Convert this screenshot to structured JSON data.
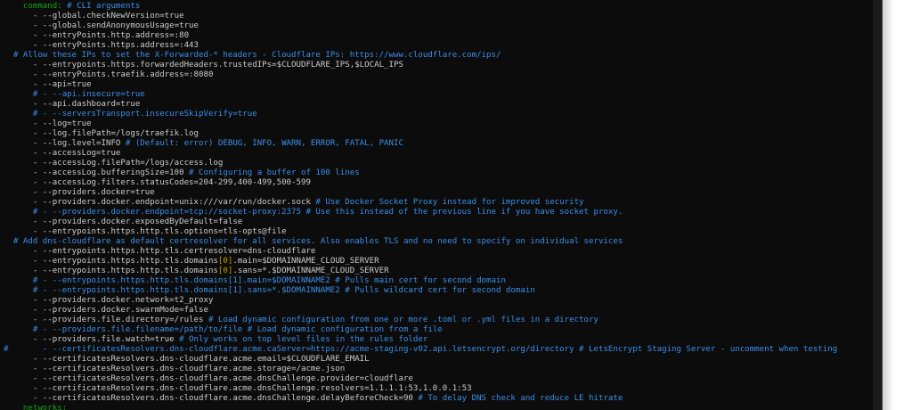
{
  "terminal": {
    "lines": [
      [
        {
          "c": "k",
          "t": "    command:"
        },
        {
          "c": "c",
          "t": " # CLI arguments"
        }
      ],
      [
        {
          "c": "n",
          "t": "      - --global.checkNewVersion=true"
        }
      ],
      [
        {
          "c": "n",
          "t": "      - --global.sendAnonymousUsage=true"
        }
      ],
      [
        {
          "c": "n",
          "t": "      - --entryPoints.http.address=:80"
        }
      ],
      [
        {
          "c": "n",
          "t": "      - --entryPoints.https.address=:443"
        }
      ],
      [
        {
          "c": "c",
          "t": "  # Allow these IPs to set the X-Forwarded-* headers - Cloudflare IPs: https://www.cloudflare.com/ips/"
        }
      ],
      [
        {
          "c": "n",
          "t": "      - --entrypoints.https.forwardedHeaders.trustedIPs=$CLOUDFLARE_IPS,$LOCAL_IPS"
        }
      ],
      [
        {
          "c": "n",
          "t": "      - --entryPoints.traefik.address=:8080"
        }
      ],
      [
        {
          "c": "n",
          "t": "      - --api=true"
        }
      ],
      [
        {
          "c": "c",
          "t": "      # - --api.insecure=true"
        }
      ],
      [
        {
          "c": "n",
          "t": "      - --api.dashboard=true"
        }
      ],
      [
        {
          "c": "c",
          "t": "      # - --serversTransport.insecureSkipVerify=true"
        }
      ],
      [
        {
          "c": "n",
          "t": "      - --log=true"
        }
      ],
      [
        {
          "c": "n",
          "t": "      - --log.filePath=/logs/traefik.log"
        }
      ],
      [
        {
          "c": "n",
          "t": "      - --log.level=INFO"
        },
        {
          "c": "c",
          "t": " # (Default: error) DEBUG, INFO, WARN, ERROR, FATAL, PANIC"
        }
      ],
      [
        {
          "c": "n",
          "t": "      - --accessLog=true"
        }
      ],
      [
        {
          "c": "n",
          "t": "      - --accessLog.filePath=/logs/access.log"
        }
      ],
      [
        {
          "c": "n",
          "t": "      - --accessLog.bufferingSize=100"
        },
        {
          "c": "c",
          "t": " # Configuring a buffer of 100 lines"
        }
      ],
      [
        {
          "c": "n",
          "t": "      - --accessLog.filters.statusCodes=204-299,400-499,500-599"
        }
      ],
      [
        {
          "c": "n",
          "t": "      - --providers.docker=true"
        }
      ],
      [
        {
          "c": "n",
          "t": "      - --providers.docker.endpoint=unix:///var/run/docker.sock"
        },
        {
          "c": "c",
          "t": " # Use Docker Socket Proxy instead for improved security"
        }
      ],
      [
        {
          "c": "c",
          "t": "      # - --providers.docker.endpoint=tcp://socket-proxy:2375 # Use this instead of the previous line if you have socket proxy."
        }
      ],
      [
        {
          "c": "n",
          "t": "      - --providers.docker.exposedByDefault=false"
        }
      ],
      [
        {
          "c": "n",
          "t": "      - --entrypoints.https.http.tls.options=tls-opts@file"
        }
      ],
      [
        {
          "c": "c",
          "t": "  # Add dns-cloudflare as default certresolver for all services. Also enables TLS and no need to specify on individual services"
        }
      ],
      [
        {
          "c": "n",
          "t": "      - --entrypoints.https.http.tls.certresolver=dns-cloudflare"
        }
      ],
      [
        {
          "c": "n",
          "t": "      - --entrypoints.https.http.tls.domains"
        },
        {
          "c": "o",
          "t": "[0]"
        },
        {
          "c": "n",
          "t": ".main=$DOMAINNAME_CLOUD_SERVER"
        }
      ],
      [
        {
          "c": "n",
          "t": "      - --entrypoints.https.http.tls.domains"
        },
        {
          "c": "o",
          "t": "[0]"
        },
        {
          "c": "n",
          "t": ".sans=*.$DOMAINNAME_CLOUD_SERVER"
        }
      ],
      [
        {
          "c": "c",
          "t": "      # - --entrypoints.https.http.tls.domains[1].main=$DOMAINNAME2 # Pulls main cert for second domain"
        }
      ],
      [
        {
          "c": "c",
          "t": "      # - --entrypoints.https.http.tls.domains[1].sans=*.$DOMAINNAME2 # Pulls wildcard cert for second domain"
        }
      ],
      [
        {
          "c": "n",
          "t": "      - --providers.docker.network=t2_proxy"
        }
      ],
      [
        {
          "c": "n",
          "t": "      - --providers.docker.swarmMode=false"
        }
      ],
      [
        {
          "c": "n",
          "t": "      - --providers.file.directory=/rules"
        },
        {
          "c": "c",
          "t": " # Load dynamic configuration from one or more .toml or .yml files in a directory"
        }
      ],
      [
        {
          "c": "c",
          "t": "      # - --providers.file.filename=/path/to/file # Load dynamic configuration from a file"
        }
      ],
      [
        {
          "c": "n",
          "t": "      - --providers.file.watch=true"
        },
        {
          "c": "c",
          "t": " # Only works on top level files in the rules folder"
        }
      ],
      [
        {
          "c": "c",
          "t": "#       - --certificatesResolvers.dns-cloudflare.acme.caServer=https://acme-staging-v02.api.letsencrypt.org/directory # LetsEncrypt Staging Server - uncomment when testing"
        }
      ],
      [
        {
          "c": "n",
          "t": "      - --certificatesResolvers.dns-cloudflare.acme.email=$CLOUDFLARE_EMAIL"
        }
      ],
      [
        {
          "c": "n",
          "t": "      - --certificatesResolvers.dns-cloudflare.acme.storage=/acme.json"
        }
      ],
      [
        {
          "c": "n",
          "t": "      - --certificatesResolvers.dns-cloudflare.acme.dnsChallenge.provider=cloudflare"
        }
      ],
      [
        {
          "c": "n",
          "t": "      - --certificatesResolvers.dns-cloudflare.acme.dnsChallenge.resolvers=1.1.1.1:53,1.0.0.1:53"
        }
      ],
      [
        {
          "c": "n",
          "t": "      - --certificatesResolvers.dns-cloudflare.acme.dnsChallenge.delayBeforeCheck=90"
        },
        {
          "c": "c",
          "t": " # To delay DNS check and reduce LE hitrate"
        }
      ],
      [
        {
          "c": "k",
          "t": "    networks:"
        }
      ]
    ]
  }
}
